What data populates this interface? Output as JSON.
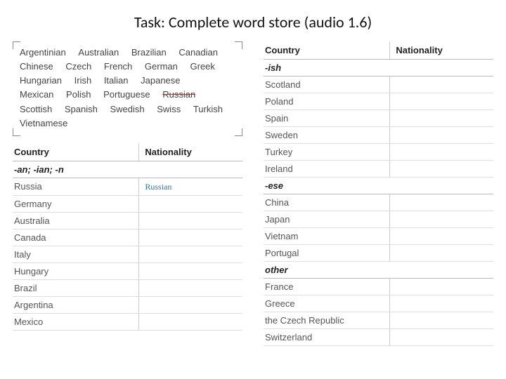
{
  "title": "Task: Complete word store (audio 1.6)",
  "wordbank": [
    {
      "w": "Argentinian",
      "struck": false
    },
    {
      "w": "Australian",
      "struck": false
    },
    {
      "w": "Brazilian",
      "struck": false
    },
    {
      "w": "Canadian",
      "struck": false
    },
    {
      "w": "Chinese",
      "struck": false
    },
    {
      "w": "Czech",
      "struck": false
    },
    {
      "w": "French",
      "struck": false
    },
    {
      "w": "German",
      "struck": false
    },
    {
      "w": "Greek",
      "struck": false
    },
    {
      "w": "Hungarian",
      "struck": false
    },
    {
      "w": "Irish",
      "struck": false
    },
    {
      "w": "Italian",
      "struck": false
    },
    {
      "w": "Japanese",
      "struck": false
    },
    {
      "w": "Mexican",
      "struck": false
    },
    {
      "w": "Polish",
      "struck": false
    },
    {
      "w": "Portuguese",
      "struck": false
    },
    {
      "w": "Russian",
      "struck": true
    },
    {
      "w": "Scottish",
      "struck": false
    },
    {
      "w": "Spanish",
      "struck": false
    },
    {
      "w": "Swedish",
      "struck": false
    },
    {
      "w": "Swiss",
      "struck": false
    },
    {
      "w": "Turkish",
      "struck": false
    },
    {
      "w": "Vietnamese",
      "struck": false
    }
  ],
  "headers": {
    "country": "Country",
    "nationality": "Nationality"
  },
  "groups": {
    "an": "-an; -ian; -n",
    "ish": "-ish",
    "ese": "-ese",
    "other": "other"
  },
  "left": {
    "an": [
      {
        "country": "Russia",
        "nat": "Russian"
      },
      {
        "country": "Germany",
        "nat": ""
      },
      {
        "country": "Australia",
        "nat": ""
      },
      {
        "country": "Canada",
        "nat": ""
      },
      {
        "country": "Italy",
        "nat": ""
      },
      {
        "country": "Hungary",
        "nat": ""
      },
      {
        "country": "Brazil",
        "nat": ""
      },
      {
        "country": "Argentina",
        "nat": ""
      },
      {
        "country": "Mexico",
        "nat": ""
      }
    ]
  },
  "right": {
    "ish": [
      {
        "country": "Scotland",
        "nat": ""
      },
      {
        "country": "Poland",
        "nat": ""
      },
      {
        "country": "Spain",
        "nat": ""
      },
      {
        "country": "Sweden",
        "nat": ""
      },
      {
        "country": "Turkey",
        "nat": ""
      },
      {
        "country": "Ireland",
        "nat": ""
      }
    ],
    "ese": [
      {
        "country": "China",
        "nat": ""
      },
      {
        "country": "Japan",
        "nat": ""
      },
      {
        "country": "Vietnam",
        "nat": ""
      },
      {
        "country": "Portugal",
        "nat": ""
      }
    ],
    "other": [
      {
        "country": "France",
        "nat": ""
      },
      {
        "country": "Greece",
        "nat": ""
      },
      {
        "country": "the Czech Republic",
        "nat": ""
      },
      {
        "country": "Switzerland",
        "nat": ""
      }
    ]
  }
}
